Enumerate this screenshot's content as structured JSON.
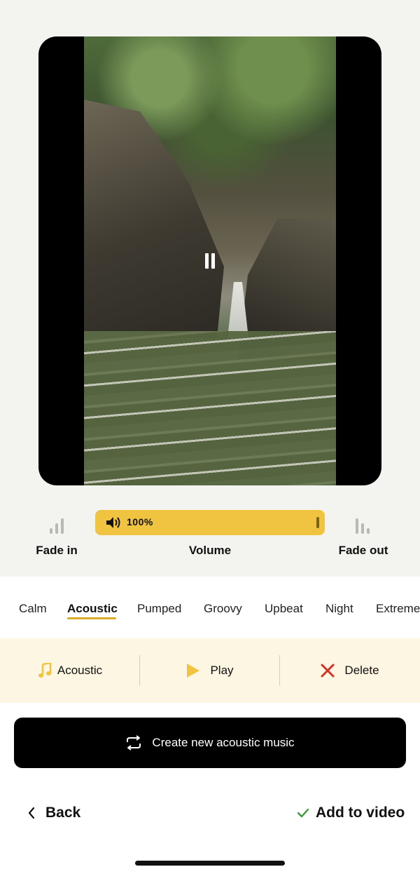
{
  "video": {
    "state": "playing",
    "pause_icon": "pause-icon"
  },
  "audio_controls": {
    "fade_in_label": "Fade in",
    "volume_label": "Volume",
    "fade_out_label": "Fade out",
    "volume_value": "100%",
    "volume_fraction": 1.0,
    "volume_icon": "speaker-icon",
    "fade_in_icon": "fade-in-bars-icon",
    "fade_out_icon": "fade-out-bars-icon"
  },
  "genres": {
    "tabs": [
      "Calm",
      "Acoustic",
      "Pumped",
      "Groovy",
      "Upbeat",
      "Night",
      "Extreme"
    ],
    "selected": "Acoustic"
  },
  "track": {
    "name": "Acoustic",
    "play_label": "Play",
    "delete_label": "Delete",
    "music_icon": "music-note-icon",
    "play_icon": "play-icon",
    "delete_icon": "close-icon"
  },
  "actions": {
    "create_label": "Create new acoustic music",
    "create_icon": "repeat-icon",
    "back_label": "Back",
    "add_label": "Add to video"
  },
  "colors": {
    "accent": "#f0c440",
    "track_bar_bg": "#fdf6e2",
    "top_bg": "#f3f3ef",
    "delete_red": "#d93025",
    "check_green": "#3a9a3a"
  }
}
